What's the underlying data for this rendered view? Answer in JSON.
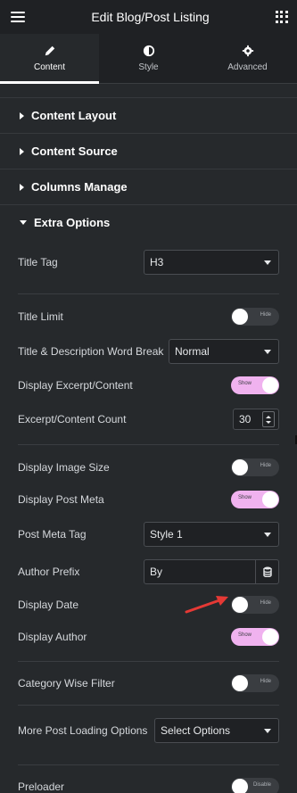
{
  "header": {
    "title": "Edit Blog/Post Listing"
  },
  "tabs": [
    {
      "label": "Content",
      "icon": "pencil-icon",
      "active": true
    },
    {
      "label": "Style",
      "icon": "half-circle-icon",
      "active": false
    },
    {
      "label": "Advanced",
      "icon": "gear-icon",
      "active": false
    }
  ],
  "sections": [
    {
      "label": "Content Layout",
      "open": false
    },
    {
      "label": "Content Source",
      "open": false
    },
    {
      "label": "Columns Manage",
      "open": false
    },
    {
      "label": "Extra Options",
      "open": true
    }
  ],
  "controls": {
    "title_tag": {
      "label": "Title Tag",
      "value": "H3"
    },
    "title_limit": {
      "label": "Title Limit",
      "toggle": "Hide",
      "on": false
    },
    "word_break": {
      "label": "Title & Description Word Break",
      "value": "Normal"
    },
    "display_excerpt": {
      "label": "Display Excerpt/Content",
      "toggle": "Show",
      "on": true
    },
    "excerpt_count": {
      "label": "Excerpt/Content Count",
      "value": "30"
    },
    "display_image_size": {
      "label": "Display Image Size",
      "toggle": "Hide",
      "on": false
    },
    "display_post_meta": {
      "label": "Display Post Meta",
      "toggle": "Show",
      "on": true
    },
    "post_meta_tag": {
      "label": "Post Meta Tag",
      "value": "Style 1"
    },
    "author_prefix": {
      "label": "Author Prefix",
      "value": "By"
    },
    "display_date": {
      "label": "Display Date",
      "toggle": "Hide",
      "on": false
    },
    "display_author": {
      "label": "Display Author",
      "toggle": "Show",
      "on": true
    },
    "category_filter": {
      "label": "Category Wise Filter",
      "toggle": "Hide",
      "on": false
    },
    "more_loading": {
      "label": "More Post Loading Options",
      "value": "Select Options"
    },
    "preloader": {
      "label": "Preloader",
      "toggle": "Disable",
      "on": false
    }
  },
  "colors": {
    "accent_toggle": "#f0b2ef",
    "annotation_arrow": "#e53935"
  }
}
